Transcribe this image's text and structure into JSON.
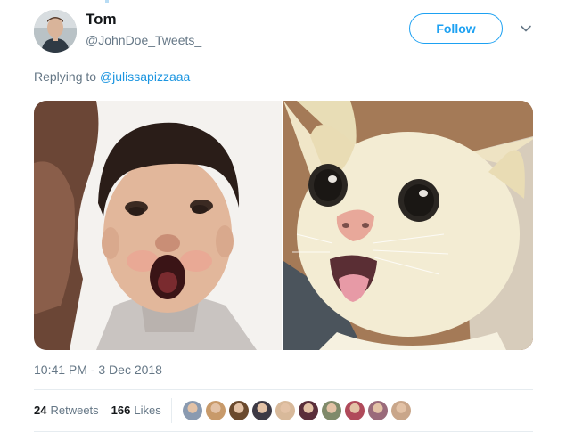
{
  "tweet": {
    "author_name": "Tom",
    "author_handle": "@JohnDoe_Tweets_",
    "follow_label": "Follow",
    "reply_prefix": "Replying to",
    "reply_to": "@julissapizzaaa",
    "timestamp": "10:41 PM - 3 Dec 2018",
    "retweets_count": "24",
    "retweets_label": "Retweets",
    "likes_count": "166",
    "likes_label": "Likes"
  },
  "colors": {
    "accent": "#1da1f2",
    "link": "#1b95e0",
    "muted": "#657786",
    "text": "#14171a",
    "divider": "#e6ecf0"
  },
  "icons": {
    "more_menu": "chevron-down-icon"
  },
  "likers": [
    {
      "name": "liker-avatar-1",
      "color": "#8a9ab0"
    },
    {
      "name": "liker-avatar-2",
      "color": "#c89a6a"
    },
    {
      "name": "liker-avatar-3",
      "color": "#6b4a2e"
    },
    {
      "name": "liker-avatar-4",
      "color": "#3d3a45"
    },
    {
      "name": "liker-avatar-5",
      "color": "#d8b99a"
    },
    {
      "name": "liker-avatar-6",
      "color": "#5a2e3a"
    },
    {
      "name": "liker-avatar-7",
      "color": "#7f8a6a"
    },
    {
      "name": "liker-avatar-8",
      "color": "#b04a5a"
    },
    {
      "name": "liker-avatar-9",
      "color": "#9a6a7a"
    },
    {
      "name": "liker-avatar-10",
      "color": "#c9a68a"
    }
  ]
}
